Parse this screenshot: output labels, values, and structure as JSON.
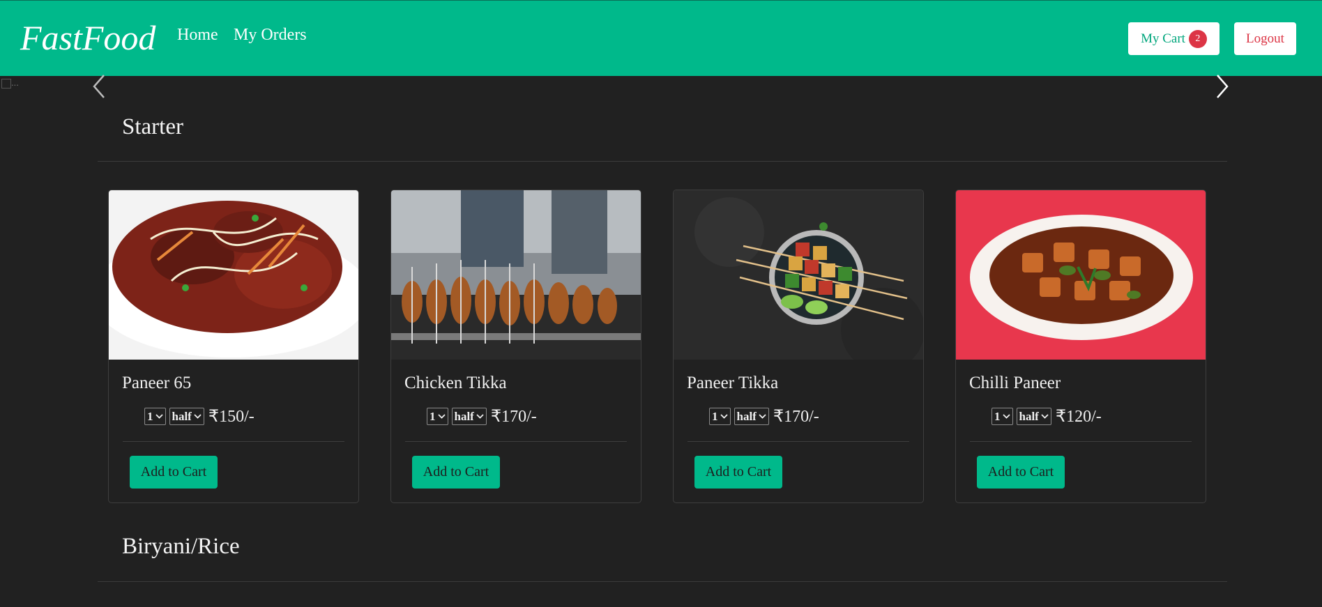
{
  "nav": {
    "brand": "FastFood",
    "links": {
      "home": "Home",
      "orders": "My Orders"
    },
    "cart_label": "My Cart",
    "cart_count": "2",
    "logout_label": "Logout"
  },
  "carousel": {
    "image_alt": "..."
  },
  "sections": [
    {
      "title": "Starter",
      "items": [
        {
          "name": "Paneer 65",
          "qty": "1",
          "size": "half",
          "price": "₹150/-",
          "add_label": "Add to Cart"
        },
        {
          "name": "Chicken Tikka",
          "qty": "1",
          "size": "half",
          "price": "₹170/-",
          "add_label": "Add to Cart"
        },
        {
          "name": "Paneer Tikka",
          "qty": "1",
          "size": "half",
          "price": "₹170/-",
          "add_label": "Add to Cart"
        },
        {
          "name": "Chilli Paneer",
          "qty": "1",
          "size": "half",
          "price": "₹120/-",
          "add_label": "Add to Cart"
        }
      ]
    },
    {
      "title": "Biryani/Rice"
    }
  ],
  "colors": {
    "accent": "#00b98b",
    "background": "#212121",
    "danger": "#dc3545"
  }
}
